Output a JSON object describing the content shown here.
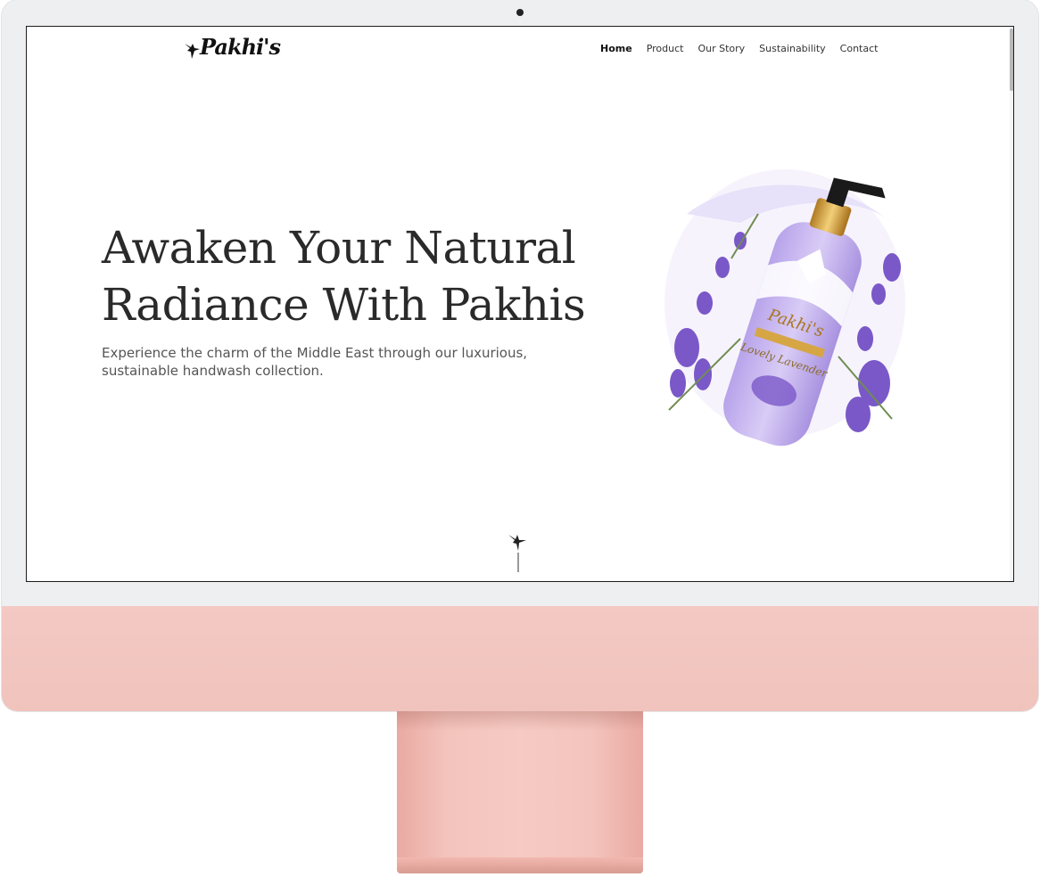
{
  "brand": {
    "logo_text": "Pakhi's"
  },
  "nav": {
    "items": [
      {
        "label": "Home",
        "active": true
      },
      {
        "label": "Product",
        "active": false
      },
      {
        "label": "Our Story",
        "active": false
      },
      {
        "label": "Sustainability",
        "active": false
      },
      {
        "label": "Contact",
        "active": false
      }
    ]
  },
  "hero": {
    "title_line1": "Awaken Your Natural",
    "title_line2": "Radiance With Pakhis",
    "subtitle": "Experience the charm of the Middle East through our luxurious, sustainable handwash collection."
  },
  "product": {
    "brand": "Pakhi's",
    "name": "Lovely Lavender",
    "icon": "handwash-bottle-icon"
  },
  "colors": {
    "monitor_chin": "#f2c4be",
    "monitor_bezel": "#eeeff1",
    "lavender": "#a48ad8",
    "gold": "#c9973a"
  }
}
